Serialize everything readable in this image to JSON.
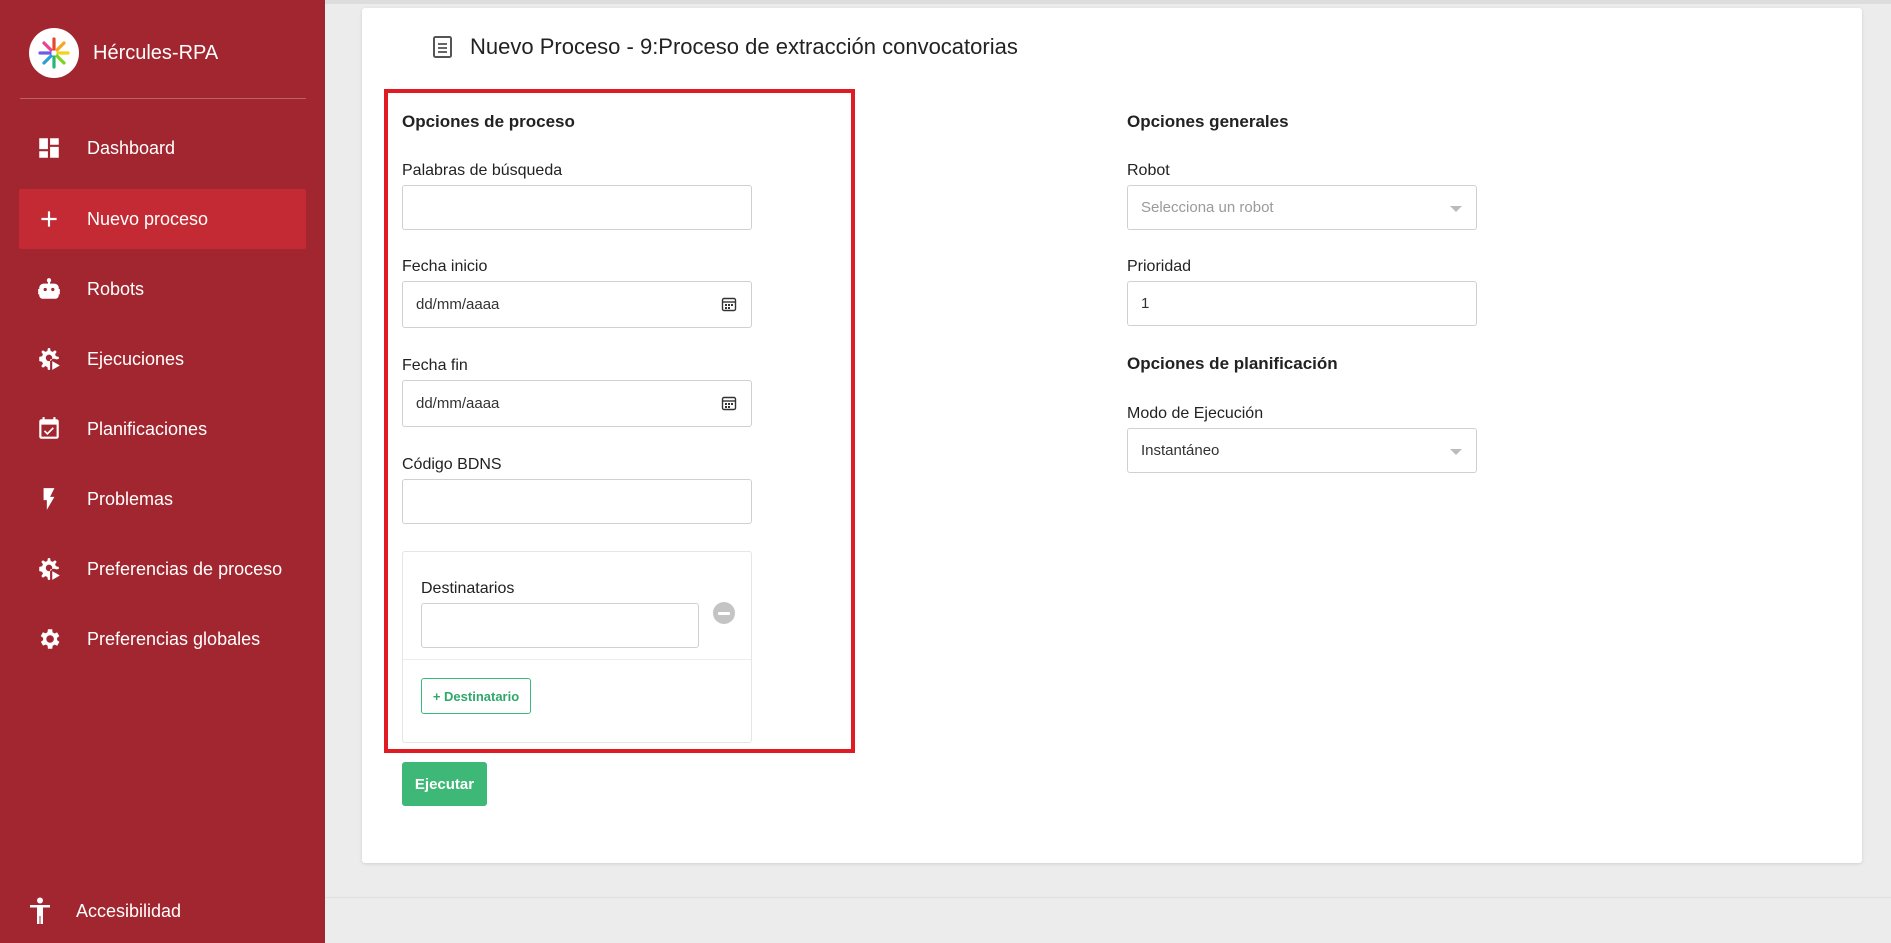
{
  "app": {
    "name": "Hércules-RPA"
  },
  "sidebar": {
    "items": [
      {
        "label": "Dashboard",
        "icon": "dashboard-icon",
        "active": false
      },
      {
        "label": "Nuevo proceso",
        "icon": "plus-icon",
        "active": true
      },
      {
        "label": "Robots",
        "icon": "robot-icon",
        "active": false
      },
      {
        "label": "Ejecuciones",
        "icon": "gear-play-icon",
        "active": false
      },
      {
        "label": "Planificaciones",
        "icon": "calendar-check-icon",
        "active": false
      },
      {
        "label": "Problemas",
        "icon": "lightning-icon",
        "active": false
      },
      {
        "label": "Preferencias de proceso",
        "icon": "gear-play-icon",
        "active": false
      },
      {
        "label": "Preferencias globales",
        "icon": "gear-icon",
        "active": false
      }
    ],
    "accessibility": "Accesibilidad"
  },
  "page": {
    "title": "Nuevo Proceso - 9:Proceso de extracción convocatorias"
  },
  "process_options": {
    "title": "Opciones de proceso",
    "search_words_label": "Palabras de búsqueda",
    "search_words_value": "",
    "start_date_label": "Fecha inicio",
    "start_date_value": "dd/mm/aaaa",
    "end_date_label": "Fecha fin",
    "end_date_value": "dd/mm/aaaa",
    "bdns_label": "Código BDNS",
    "bdns_value": "",
    "recipients_label": "Destinatarios",
    "recipient_value": "",
    "add_recipient_label": "+ Destinatario"
  },
  "general_options": {
    "title": "Opciones generales",
    "robot_label": "Robot",
    "robot_placeholder": "Selecciona un robot",
    "priority_label": "Prioridad",
    "priority_value": "1"
  },
  "planning_options": {
    "title": "Opciones de planificación",
    "mode_label": "Modo de Ejecución",
    "mode_value": "Instantáneo"
  },
  "actions": {
    "run_label": "Ejecutar"
  },
  "colors": {
    "sidebar": "#a2262f",
    "active_item": "#c42a33",
    "highlight": "#e01b24",
    "accent": "#3db876"
  }
}
